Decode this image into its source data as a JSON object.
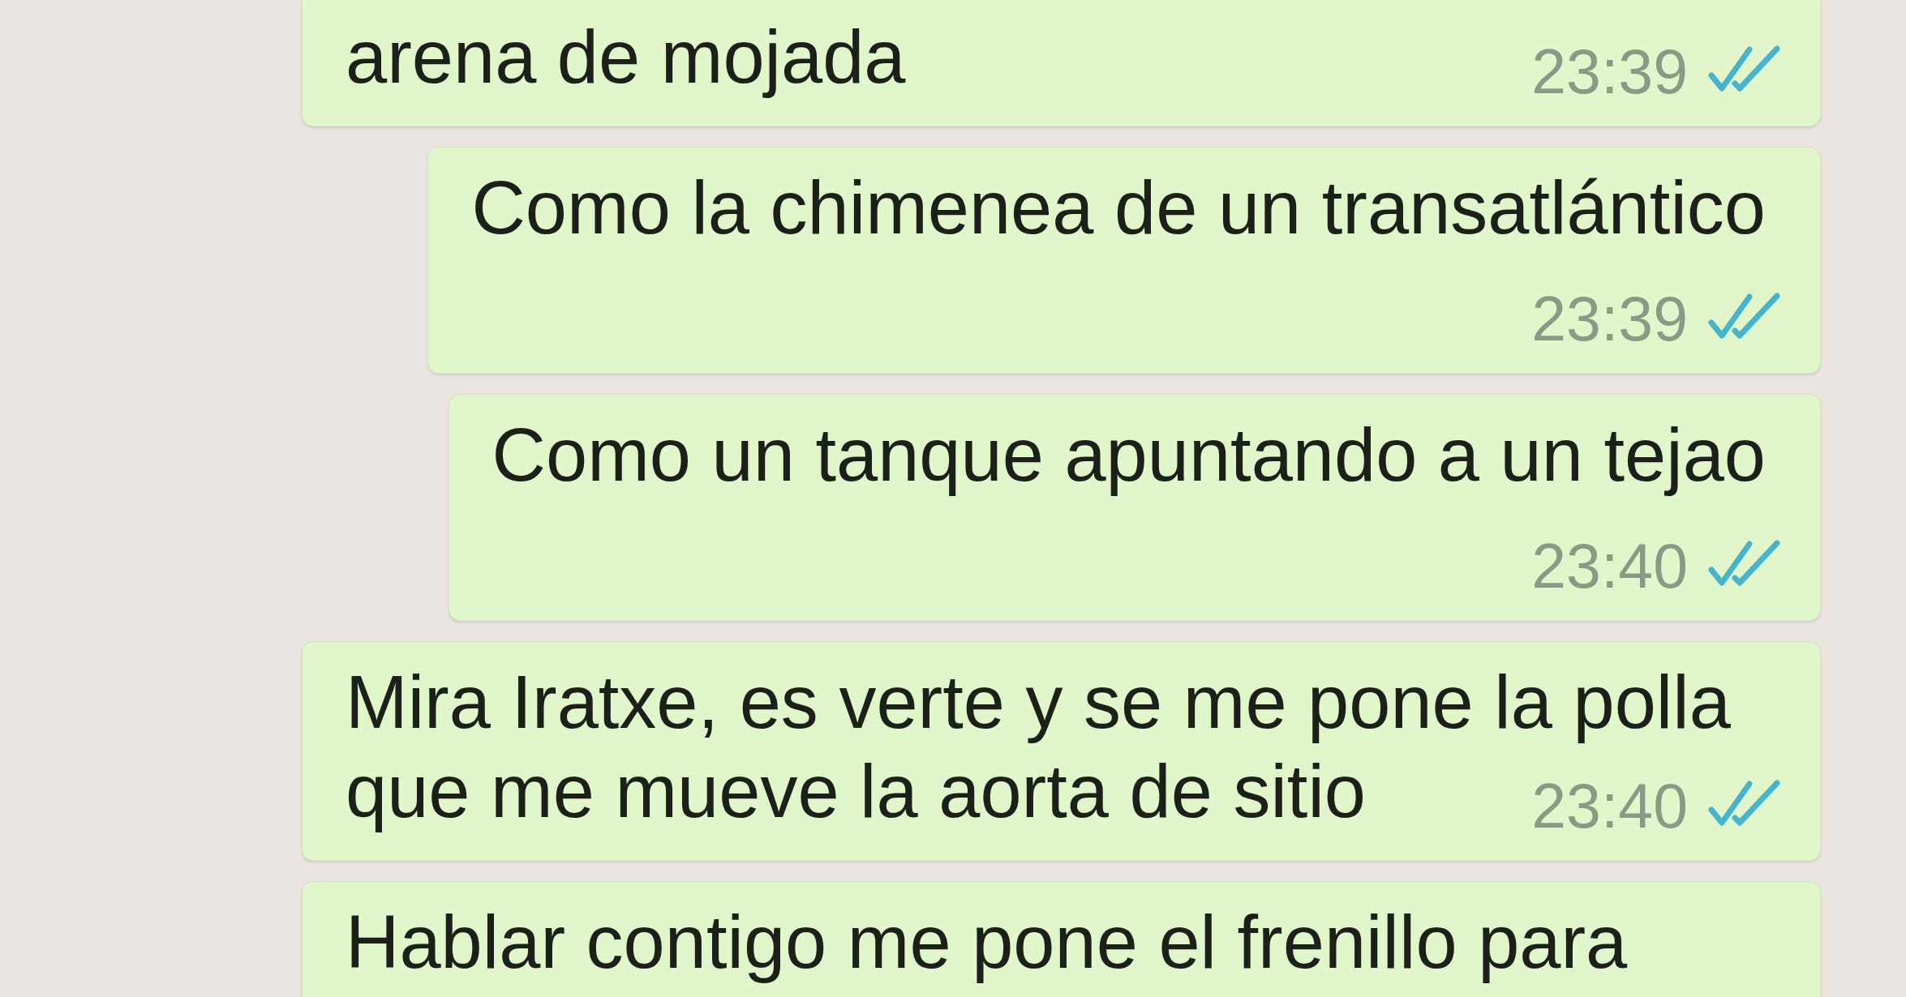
{
  "messages": [
    {
      "lines": [
        "arena de mojada"
      ],
      "time": "23:39",
      "read": true,
      "clipped_top": true
    },
    {
      "lines": [
        "Como la chimenea de un transatlántico"
      ],
      "time": "23:39",
      "read": true
    },
    {
      "lines": [
        "Como un tanque apuntando a un tejao"
      ],
      "time": "23:40",
      "read": true
    },
    {
      "lines": [
        "Mira Iratxe, es verte y se me pone la polla",
        "que me mueve la aorta de sitio"
      ],
      "time": "23:40",
      "read": true
    },
    {
      "lines": [
        "Hablar contigo me pone el frenillo para"
      ],
      "clipped_bottom": true
    }
  ]
}
